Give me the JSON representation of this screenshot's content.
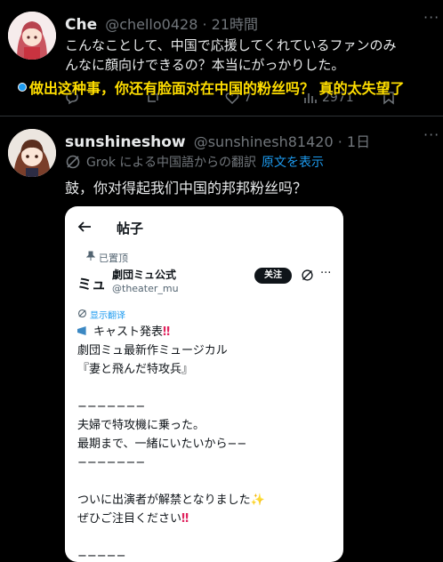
{
  "post1": {
    "name": "Che",
    "handle": "@chello0428",
    "time": "21時間",
    "text_line1": "こんなことして、中国で応援してくれているファンのみ",
    "text_line2": "んなに顔向けできるの？本当にがっかりした。",
    "subtitle": "做出这种事，你还有脸面对在中国的粉丝吗？ 真的太失望了",
    "likes": "7",
    "views": "2971"
  },
  "post2": {
    "name": "sunshineshow",
    "handle": "@sunshinesh81420",
    "time": "1日",
    "grok_label": "Grok による中国語からの翻訳",
    "show_original": "原文を表示",
    "text": "鼓，你对得起我们中国的邦邦粉丝吗？"
  },
  "card": {
    "title": "帖子",
    "pinned": "已置顶",
    "logo": "ミュ",
    "account_name": "劇団ミュ公式",
    "account_handle": "@theater_mu",
    "follow": "关注",
    "translate": "显示翻译",
    "line1": "キャスト発表",
    "line2": "劇団ミュ最新作ミュージカル",
    "line3": "『妻と飛んだ特攻兵』",
    "line4": "−−−−−−−",
    "line5": "夫婦で特攻機に乗った。",
    "line6": "最期まで、一緒にいたいから−−",
    "line7": "−−−−−−−",
    "line8": "ついに出演者が解禁となりました",
    "line9": "ぜひご注目ください",
    "line10": "−−−−−"
  },
  "colors": {
    "accent": "#1d9bf0",
    "subtitle": "#ffde00"
  }
}
